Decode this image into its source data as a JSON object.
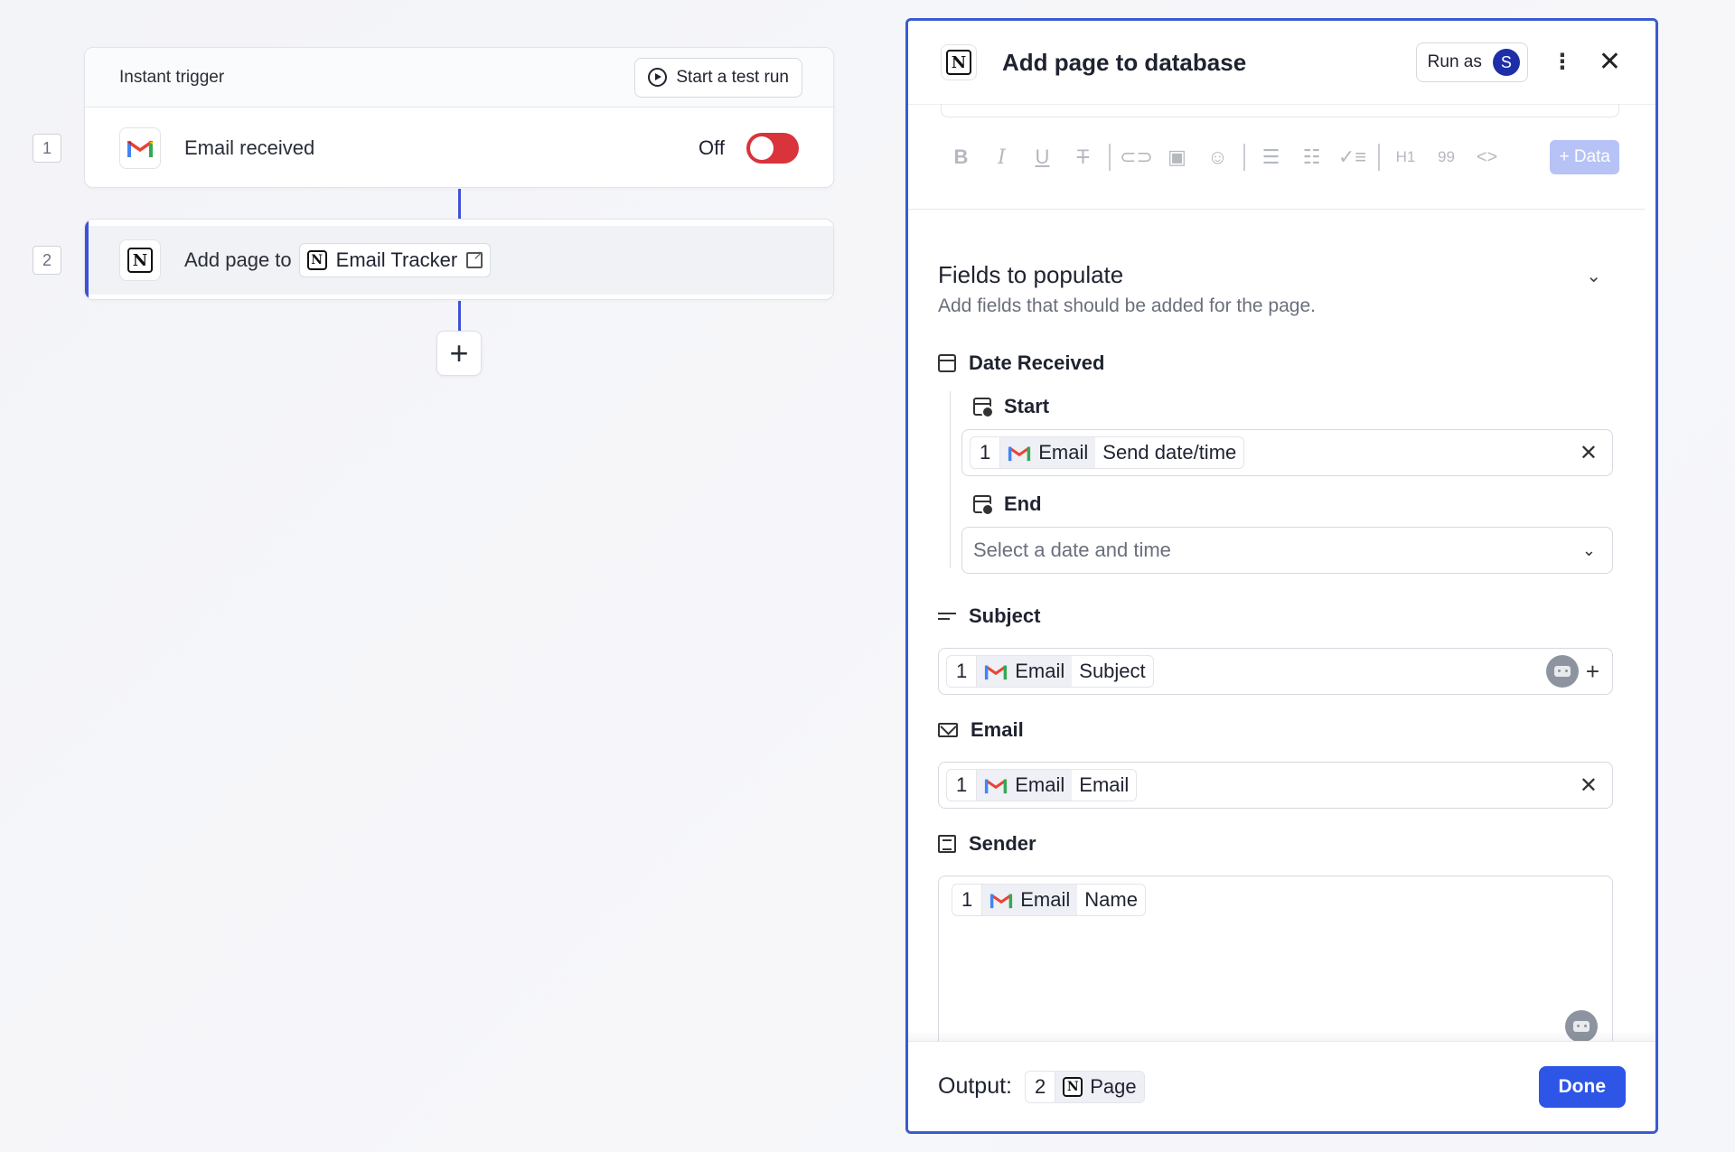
{
  "canvas": {
    "trigger": {
      "step_number": "1",
      "header_title": "Instant trigger",
      "test_run_label": "Start a test run",
      "event_label": "Email received",
      "status_label": "Off"
    },
    "action": {
      "step_number": "2",
      "prefix_label": "Add page to",
      "database_label": "Email Tracker"
    }
  },
  "panel": {
    "title": "Add page to database",
    "run_as_label": "Run as",
    "avatar_initial": "S",
    "toolbar": {
      "items": [
        "bold-icon",
        "italic-icon",
        "underline-icon",
        "strikethrough-icon",
        "link-icon",
        "image-icon",
        "emoji-icon",
        "bulleted-list-icon",
        "numbered-list-icon",
        "checklist-icon",
        "heading-icon",
        "quote-icon",
        "code-icon"
      ],
      "h1_label": "H1",
      "quote_label": "99",
      "code_label": "<>",
      "data_button_label": "+ Data"
    },
    "fields_section": {
      "title": "Fields to populate",
      "subtitle": "Add fields that should be added for the page."
    },
    "date_received": {
      "label": "Date Received",
      "start": {
        "label": "Start",
        "token": {
          "step": "1",
          "app": "Email",
          "field": "Send date/time"
        }
      },
      "end": {
        "label": "End",
        "placeholder": "Select a date and time"
      }
    },
    "subject": {
      "label": "Subject",
      "token": {
        "step": "1",
        "app": "Email",
        "field": "Subject"
      }
    },
    "email": {
      "label": "Email",
      "token": {
        "step": "1",
        "app": "Email",
        "field": "Email"
      }
    },
    "sender": {
      "label": "Sender",
      "token": {
        "step": "1",
        "app": "Email",
        "field": "Name"
      }
    },
    "footer": {
      "output_label": "Output:",
      "output_token": {
        "step": "2",
        "field": "Page"
      },
      "done_label": "Done"
    }
  },
  "colors": {
    "accent": "#3f51d6",
    "panel_border": "#3a5bd0",
    "toggle_off": "#d9333b",
    "done_button": "#2d55e6",
    "data_button": "#b7c2f7",
    "avatar": "#1d2fa8"
  }
}
